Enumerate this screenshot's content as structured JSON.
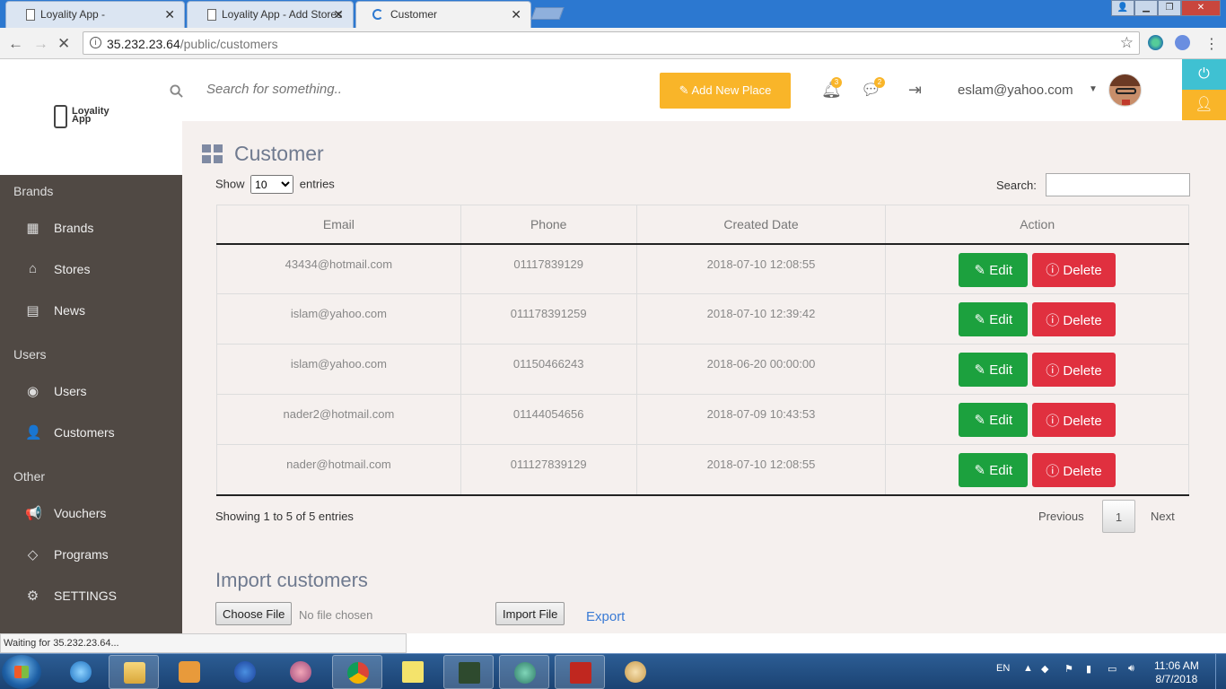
{
  "browser": {
    "tabs": [
      {
        "title": "Loyality App -",
        "active": false
      },
      {
        "title": "Loyality App - Add Stores",
        "active": false
      },
      {
        "title": "Customer",
        "active": true
      }
    ],
    "url_host": "35.232.23.64",
    "url_path": "/public/customers",
    "status_text": "Waiting for 35.232.23.64..."
  },
  "logo": {
    "line1": "Loyality",
    "line2": "App"
  },
  "sidebar": {
    "sections": [
      {
        "label": "Brands",
        "items": [
          {
            "label": "Brands",
            "icon": "grid-icon"
          },
          {
            "label": "Stores",
            "icon": "home-icon"
          },
          {
            "label": "News",
            "icon": "newspaper-icon"
          }
        ]
      },
      {
        "label": "Users",
        "items": [
          {
            "label": "Users",
            "icon": "user-circle-icon"
          },
          {
            "label": "Customers",
            "icon": "user-icon"
          }
        ]
      },
      {
        "label": "Other",
        "items": [
          {
            "label": "Vouchers",
            "icon": "megaphone-icon"
          },
          {
            "label": "Programs",
            "icon": "diamond-icon"
          },
          {
            "label": "SETTINGS",
            "icon": "gear-icon"
          }
        ]
      }
    ]
  },
  "header": {
    "search_placeholder": "Search for something..",
    "add_button": "Add New Place",
    "notifications_count": "3",
    "messages_count": "2",
    "user_email": "eslam@yahoo.com",
    "accent": "#f9b529"
  },
  "page": {
    "title": "Customer",
    "show_label": "Show",
    "entries_value": "10",
    "entries_label": "entries",
    "search_label": "Search:",
    "columns": [
      "Email",
      "Phone",
      "Created Date",
      "Action"
    ],
    "rows": [
      {
        "email": "43434@hotmail.com",
        "phone": "01117839129",
        "created": "2018-07-10 12:08:55"
      },
      {
        "email": "islam@yahoo.com",
        "phone": "011178391259",
        "created": "2018-07-10 12:39:42"
      },
      {
        "email": "islam@yahoo.com",
        "phone": "01150466243",
        "created": "2018-06-20 00:00:00"
      },
      {
        "email": "nader2@hotmail.com",
        "phone": "01144054656",
        "created": "2018-07-09 10:43:53"
      },
      {
        "email": "nader@hotmail.com",
        "phone": "011127839129",
        "created": "2018-07-10 12:08:55"
      }
    ],
    "edit_label": "Edit",
    "delete_label": "Delete",
    "showing_text": "Showing 1 to 5 of 5 entries",
    "pagination": {
      "previous": "Previous",
      "current": "1",
      "next": "Next"
    },
    "import_title": "Import customers",
    "choose_file": "Choose File",
    "no_file": "No file chosen",
    "import_file": "Import File",
    "export": "Export"
  },
  "taskbar": {
    "lang": "EN",
    "time": "11:06 AM",
    "date": "8/7/2018"
  }
}
